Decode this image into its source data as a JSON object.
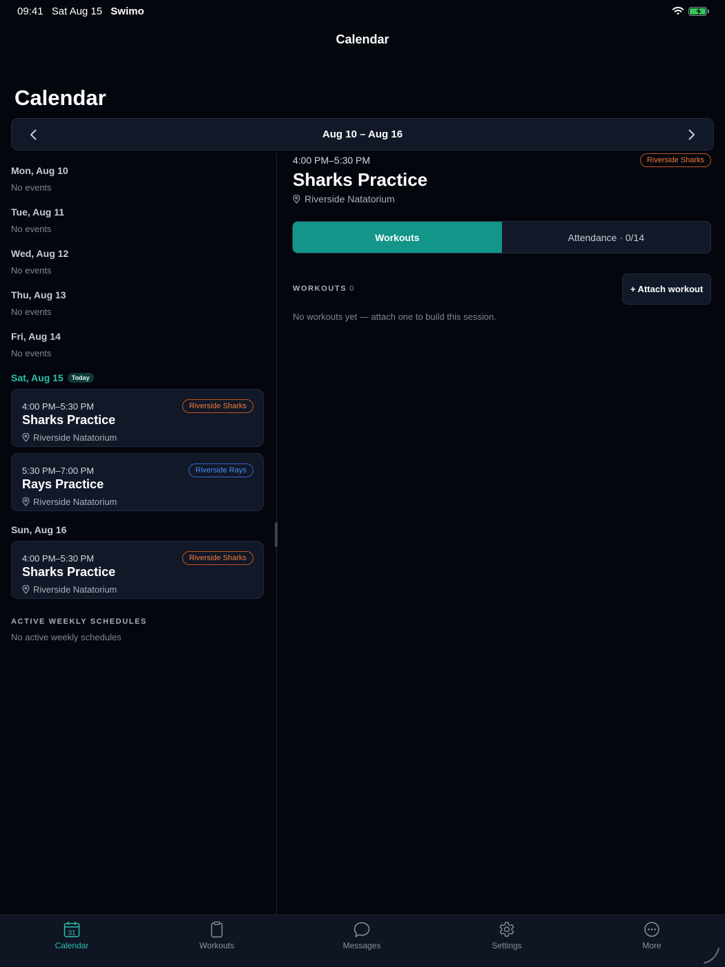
{
  "status_bar": {
    "time": "09:41",
    "date": "Sat Aug 15",
    "app": "Swimo"
  },
  "nav": {
    "title": "Calendar"
  },
  "page": {
    "large_title": "Calendar"
  },
  "week": {
    "range": "Aug 10 – Aug 16"
  },
  "days": [
    {
      "label": "Mon, Aug 10",
      "empty": "No events"
    },
    {
      "label": "Tue, Aug 11",
      "empty": "No events"
    },
    {
      "label": "Wed, Aug 12",
      "empty": "No events"
    },
    {
      "label": "Thu, Aug 13",
      "empty": "No events"
    },
    {
      "label": "Fri, Aug 14",
      "empty": "No events"
    }
  ],
  "today": {
    "label": "Sat, Aug 15",
    "badge": "Today",
    "events": [
      {
        "time": "4:00 PM–5:30 PM",
        "title": "Sharks Practice",
        "location": "Riverside Natatorium",
        "team": "Riverside Sharks"
      },
      {
        "time": "5:30 PM–7:00 PM",
        "title": "Rays Practice",
        "location": "Riverside Natatorium",
        "team": "Riverside Rays"
      }
    ]
  },
  "sunday": {
    "label": "Sun, Aug 16",
    "events": [
      {
        "time": "4:00 PM–5:30 PM",
        "title": "Sharks Practice",
        "location": "Riverside Natatorium",
        "team": "Riverside Sharks"
      }
    ]
  },
  "schedules": {
    "heading": "ACTIVE WEEKLY SCHEDULES",
    "empty": "No active weekly schedules"
  },
  "detail": {
    "time": "4:00 PM–5:30 PM",
    "title": "Sharks Practice",
    "location": "Riverside Natatorium",
    "team": "Riverside Sharks",
    "tabs": {
      "workouts": "Workouts",
      "attendance": "Attendance · 0/14"
    },
    "workouts_heading": "WORKOUTS",
    "workouts_count": "0",
    "attach_label": "+ Attach workout",
    "workouts_empty": "No workouts yet — attach one to build this session."
  },
  "tabbar": [
    {
      "label": "Calendar",
      "icon": "calendar-icon",
      "calendar_day": "31"
    },
    {
      "label": "Workouts",
      "icon": "clipboard-icon"
    },
    {
      "label": "Messages",
      "icon": "chat-bubble-icon"
    },
    {
      "label": "Settings",
      "icon": "gear-icon"
    },
    {
      "label": "More",
      "icon": "more-dots-icon"
    }
  ],
  "colors": {
    "accent": "#14958a",
    "accent_text": "#2fbfae",
    "sharks": "#f07a3c",
    "rays": "#4b8cf5",
    "background": "#03060d",
    "card": "#111827"
  }
}
